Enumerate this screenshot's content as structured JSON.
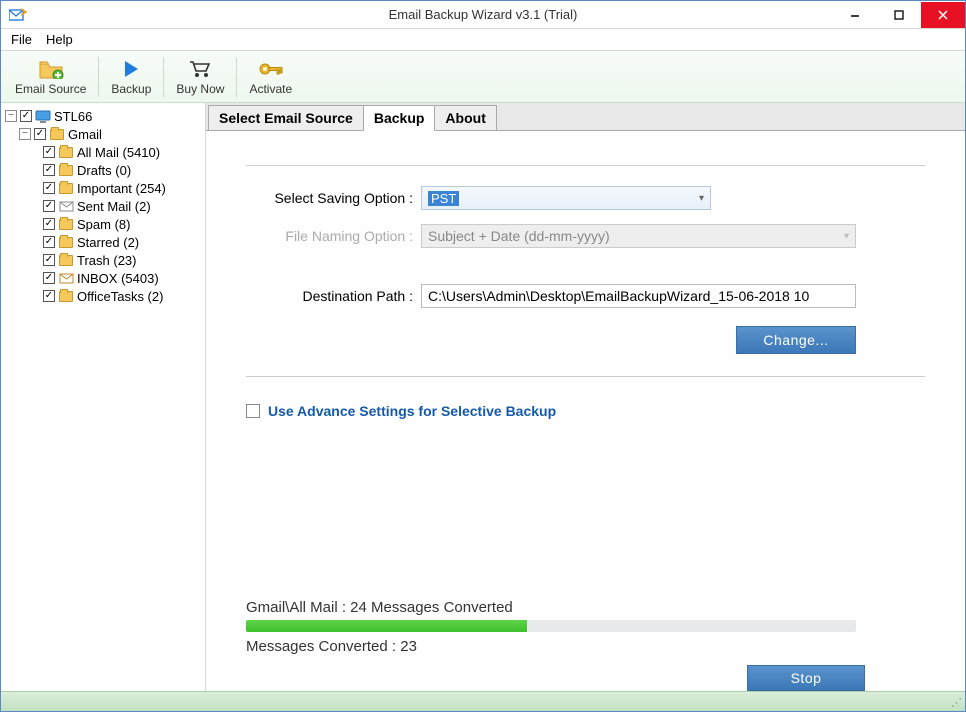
{
  "window": {
    "title": "Email Backup Wizard v3.1 (Trial)"
  },
  "menubar": {
    "file": "File",
    "help": "Help"
  },
  "toolbar": {
    "email_source": "Email Source",
    "backup": "Backup",
    "buy_now": "Buy Now",
    "activate": "Activate"
  },
  "tree": {
    "root": "STL66",
    "gmail": "Gmail",
    "items": [
      {
        "label": "All Mail (5410)"
      },
      {
        "label": "Drafts (0)"
      },
      {
        "label": "Important (254)"
      },
      {
        "label": "Sent Mail (2)"
      },
      {
        "label": "Spam (8)"
      },
      {
        "label": "Starred (2)"
      },
      {
        "label": "Trash (23)"
      },
      {
        "label": "INBOX (5403)"
      },
      {
        "label": "OfficeTasks (2)"
      }
    ]
  },
  "tabs": {
    "source": "Select Email Source",
    "backup": "Backup",
    "about": "About"
  },
  "form": {
    "save_label": "Select Saving Option  :",
    "save_value": "PST",
    "naming_label": "File Naming Option  :",
    "naming_value": "Subject + Date (dd-mm-yyyy)",
    "dest_label": "Destination Path  :",
    "dest_value": "C:\\Users\\Admin\\Desktop\\EmailBackupWizard_15-06-2018 10",
    "change_btn": "Change...",
    "advance_label": "Use Advance Settings for Selective Backup"
  },
  "progress": {
    "line1": "Gmail\\All Mail : 24 Messages Converted",
    "line2": "Messages Converted : 23",
    "percent": 46
  },
  "buttons": {
    "stop": "Stop"
  }
}
